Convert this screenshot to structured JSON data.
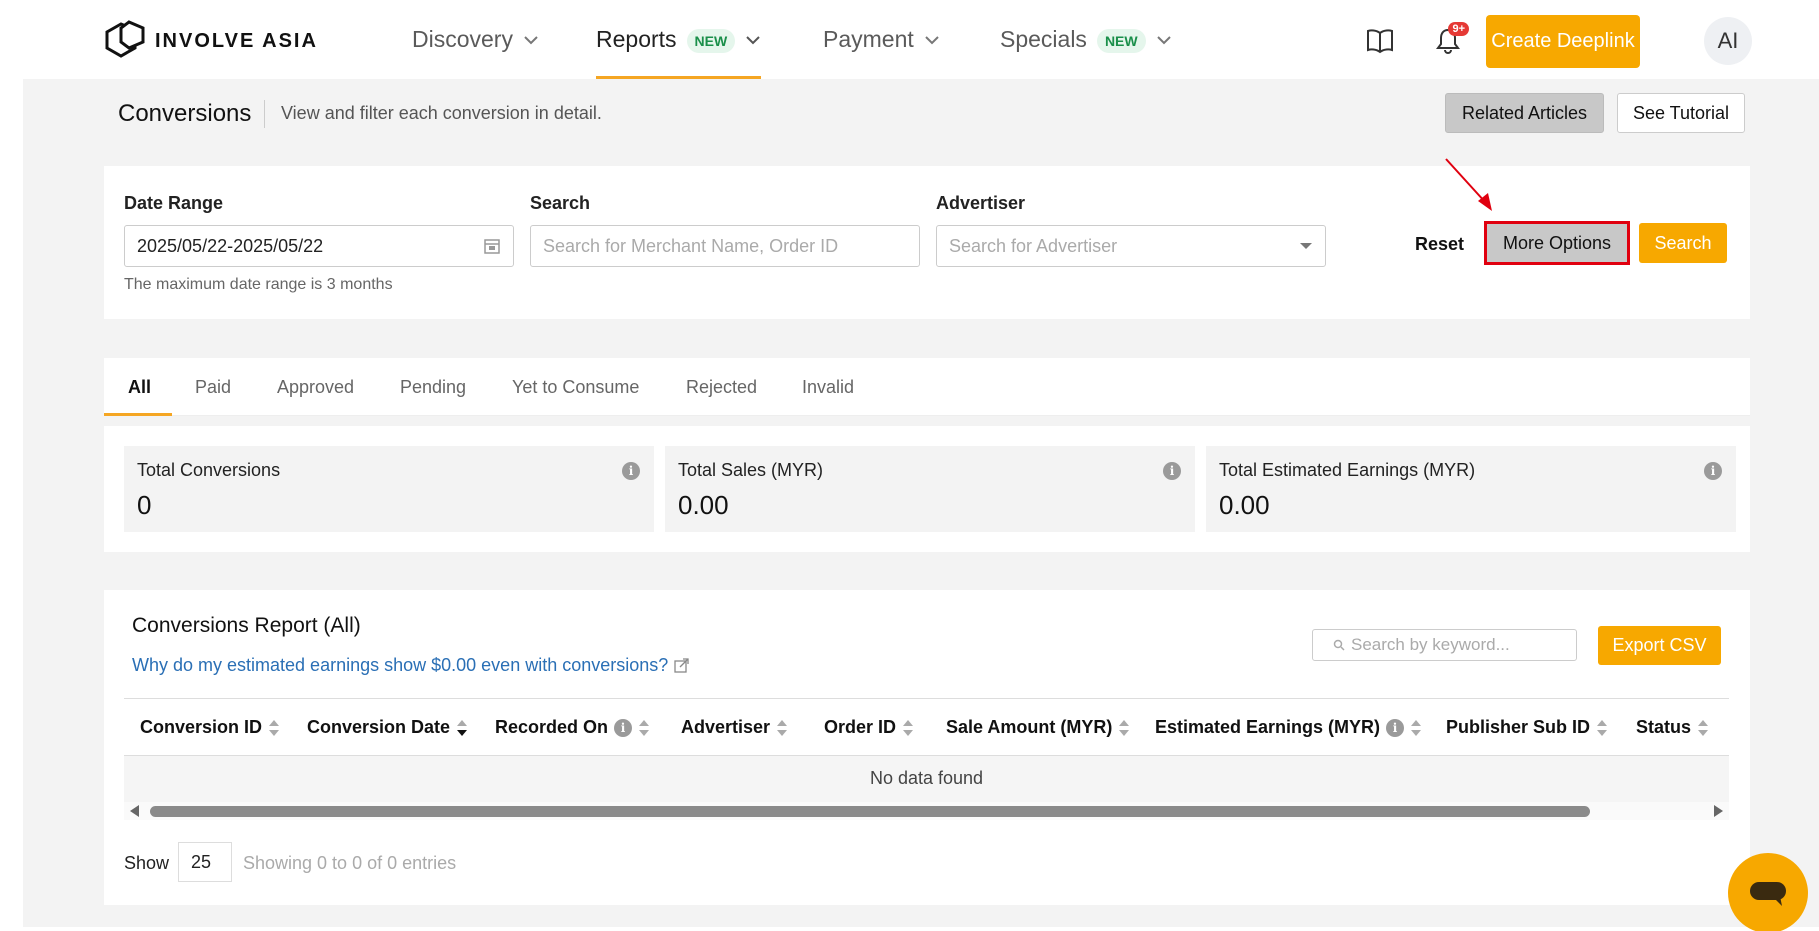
{
  "brand": {
    "name": "INVOLVE ASIA"
  },
  "nav": {
    "items": [
      {
        "label": "Discovery",
        "badge": ""
      },
      {
        "label": "Reports",
        "badge": "NEW"
      },
      {
        "label": "Payment",
        "badge": ""
      },
      {
        "label": "Specials",
        "badge": "NEW"
      }
    ],
    "notifications_count": "9+",
    "create_label": "Create Deeplink",
    "avatar_initials": "AI"
  },
  "header": {
    "title": "Conversions",
    "subtitle": "View and filter each conversion in detail.",
    "related_label": "Related Articles",
    "tutorial_label": "See Tutorial"
  },
  "filters": {
    "date_label": "Date Range",
    "date_value": "2025/05/22-2025/05/22",
    "date_hint": "The maximum date range is 3 months",
    "search_label": "Search",
    "search_placeholder": "Search for Merchant Name, Order ID",
    "advertiser_label": "Advertiser",
    "advertiser_placeholder": "Search for Advertiser",
    "reset_label": "Reset",
    "more_label": "More Options",
    "search_btn_label": "Search"
  },
  "tabs": [
    "All",
    "Paid",
    "Approved",
    "Pending",
    "Yet to Consume",
    "Rejected",
    "Invalid"
  ],
  "stats": [
    {
      "label": "Total Conversions",
      "value": "0"
    },
    {
      "label": "Total Sales (MYR)",
      "value": "0.00"
    },
    {
      "label": "Total Estimated Earnings (MYR)",
      "value": "0.00"
    }
  ],
  "report": {
    "title": "Conversions Report (All)",
    "link": "Why do my estimated earnings show $0.00 even with conversions?",
    "keyword_placeholder": "Search by keyword...",
    "export_label": "Export CSV",
    "columns": [
      "Conversion ID",
      "Conversion Date",
      "Recorded On",
      "Advertiser",
      "Order ID",
      "Sale Amount (MYR)",
      "Estimated Earnings (MYR)",
      "Publisher Sub ID",
      "Status"
    ],
    "empty_text": "No data found",
    "show_label": "Show",
    "page_size": "25",
    "entries_text": "Showing 0 to 0 of 0 entries"
  },
  "colors": {
    "accent": "#f7a800",
    "highlight": "#e0000f",
    "link": "#2a6fb5"
  }
}
